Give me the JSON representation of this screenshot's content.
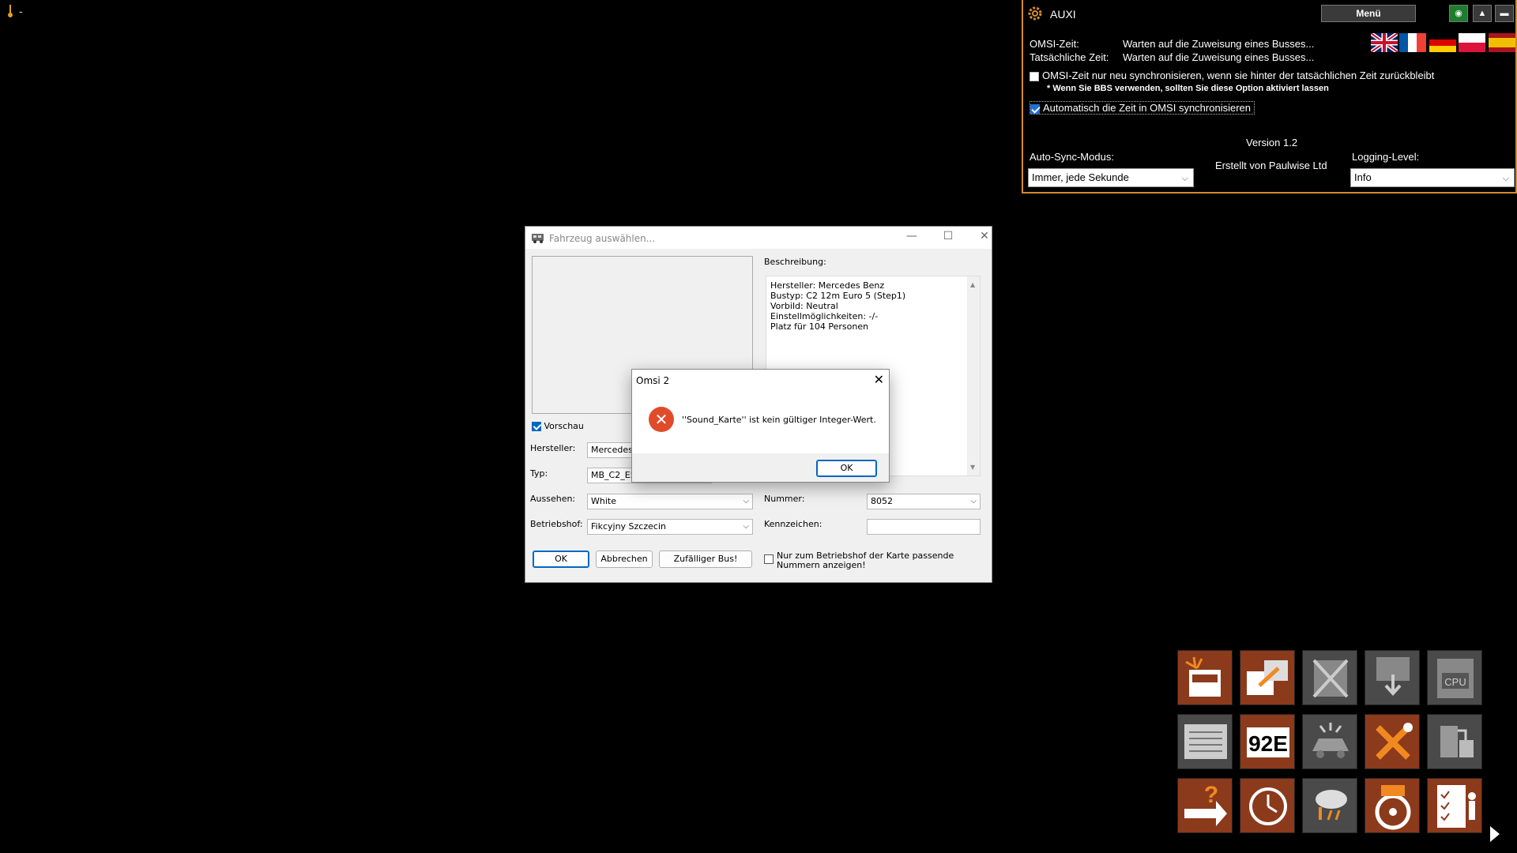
{
  "tray": {
    "dash": "-"
  },
  "auxi": {
    "title": "AUXI",
    "menu_label": "Menü",
    "omsi_time_label": "OMSI-Zeit:",
    "omsi_time_value": "Warten auf die Zuweisung eines Busses...",
    "real_time_label": "Tatsächliche Zeit:",
    "real_time_value": "Warten auf die Zuweisung eines Busses...",
    "resync_option": "OMSI-Zeit nur neu synchronisieren, wenn sie hinter der tatsächlichen Zeit zurückbleibt",
    "bbs_note": "* Wenn Sie BBS verwenden, sollten Sie diese Option aktiviert lassen",
    "autosync_option": "Automatisch die Zeit in OMSI synchronisieren",
    "version": "Version 1.2",
    "author": "Erstellt von Paulwise Ltd",
    "autosync_mode_label": "Auto-Sync-Modus:",
    "autosync_mode_value": "Immer, jede Sekunde",
    "logging_label": "Logging-Level:",
    "logging_value": "Info",
    "flags": [
      "english-flag",
      "french-flag",
      "german-flag",
      "polish-flag",
      "spanish-flag"
    ]
  },
  "vehicle_dialog": {
    "title": "Fahrzeug auswählen...",
    "preview_label": "Vorschau",
    "description_label": "Beschreibung:",
    "description_lines": [
      "Hersteller: Mercedes Benz",
      "Bustyp: C2 12m Euro 5 (Step1)",
      "Vorbild: Neutral",
      "Einstellmöglichkeiten: -/-",
      "Platz für 104 Personen"
    ],
    "manufacturer_label": "Hersteller:",
    "manufacturer_value": "Mercedes-B",
    "type_label": "Typ:",
    "type_value": "MB_C2_E5",
    "appearance_label": "Aussehen:",
    "appearance_value": "White",
    "depot_label": "Betriebshof:",
    "depot_value": "Fikcyjny Szczecin",
    "number_label": "Nummer:",
    "number_value": "8052",
    "plate_label": "Kennzeichen:",
    "plate_value": "",
    "ok_label": "OK",
    "cancel_label": "Abbrechen",
    "random_label": "Zufälliger Bus!",
    "depot_numbers_option": "Nur zum Betriebshof der Karte passende Nummern anzeigen!"
  },
  "error_dialog": {
    "title": "Omsi 2",
    "message": "''Sound_Karte'' ist kein gültiger Integer-Wert.",
    "ok_label": "OK"
  },
  "colors": {
    "auxi_border": "#d58a2c",
    "tool_orange": "#8b3a1c",
    "tool_grey": "#4a4a4a",
    "accent_blue": "#0067c0",
    "error_red": "#e04b2a"
  }
}
